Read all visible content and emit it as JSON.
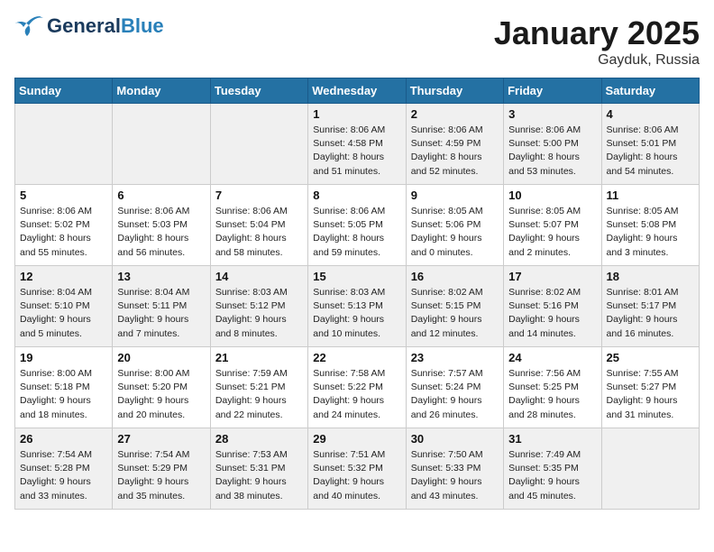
{
  "header": {
    "logo_general": "General",
    "logo_blue": "Blue",
    "month": "January 2025",
    "location": "Gayduk, Russia"
  },
  "weekdays": [
    "Sunday",
    "Monday",
    "Tuesday",
    "Wednesday",
    "Thursday",
    "Friday",
    "Saturday"
  ],
  "weeks": [
    [
      {
        "day": "",
        "info": ""
      },
      {
        "day": "",
        "info": ""
      },
      {
        "day": "",
        "info": ""
      },
      {
        "day": "1",
        "info": "Sunrise: 8:06 AM\nSunset: 4:58 PM\nDaylight: 8 hours\nand 51 minutes."
      },
      {
        "day": "2",
        "info": "Sunrise: 8:06 AM\nSunset: 4:59 PM\nDaylight: 8 hours\nand 52 minutes."
      },
      {
        "day": "3",
        "info": "Sunrise: 8:06 AM\nSunset: 5:00 PM\nDaylight: 8 hours\nand 53 minutes."
      },
      {
        "day": "4",
        "info": "Sunrise: 8:06 AM\nSunset: 5:01 PM\nDaylight: 8 hours\nand 54 minutes."
      }
    ],
    [
      {
        "day": "5",
        "info": "Sunrise: 8:06 AM\nSunset: 5:02 PM\nDaylight: 8 hours\nand 55 minutes."
      },
      {
        "day": "6",
        "info": "Sunrise: 8:06 AM\nSunset: 5:03 PM\nDaylight: 8 hours\nand 56 minutes."
      },
      {
        "day": "7",
        "info": "Sunrise: 8:06 AM\nSunset: 5:04 PM\nDaylight: 8 hours\nand 58 minutes."
      },
      {
        "day": "8",
        "info": "Sunrise: 8:06 AM\nSunset: 5:05 PM\nDaylight: 8 hours\nand 59 minutes."
      },
      {
        "day": "9",
        "info": "Sunrise: 8:05 AM\nSunset: 5:06 PM\nDaylight: 9 hours\nand 0 minutes."
      },
      {
        "day": "10",
        "info": "Sunrise: 8:05 AM\nSunset: 5:07 PM\nDaylight: 9 hours\nand 2 minutes."
      },
      {
        "day": "11",
        "info": "Sunrise: 8:05 AM\nSunset: 5:08 PM\nDaylight: 9 hours\nand 3 minutes."
      }
    ],
    [
      {
        "day": "12",
        "info": "Sunrise: 8:04 AM\nSunset: 5:10 PM\nDaylight: 9 hours\nand 5 minutes."
      },
      {
        "day": "13",
        "info": "Sunrise: 8:04 AM\nSunset: 5:11 PM\nDaylight: 9 hours\nand 7 minutes."
      },
      {
        "day": "14",
        "info": "Sunrise: 8:03 AM\nSunset: 5:12 PM\nDaylight: 9 hours\nand 8 minutes."
      },
      {
        "day": "15",
        "info": "Sunrise: 8:03 AM\nSunset: 5:13 PM\nDaylight: 9 hours\nand 10 minutes."
      },
      {
        "day": "16",
        "info": "Sunrise: 8:02 AM\nSunset: 5:15 PM\nDaylight: 9 hours\nand 12 minutes."
      },
      {
        "day": "17",
        "info": "Sunrise: 8:02 AM\nSunset: 5:16 PM\nDaylight: 9 hours\nand 14 minutes."
      },
      {
        "day": "18",
        "info": "Sunrise: 8:01 AM\nSunset: 5:17 PM\nDaylight: 9 hours\nand 16 minutes."
      }
    ],
    [
      {
        "day": "19",
        "info": "Sunrise: 8:00 AM\nSunset: 5:18 PM\nDaylight: 9 hours\nand 18 minutes."
      },
      {
        "day": "20",
        "info": "Sunrise: 8:00 AM\nSunset: 5:20 PM\nDaylight: 9 hours\nand 20 minutes."
      },
      {
        "day": "21",
        "info": "Sunrise: 7:59 AM\nSunset: 5:21 PM\nDaylight: 9 hours\nand 22 minutes."
      },
      {
        "day": "22",
        "info": "Sunrise: 7:58 AM\nSunset: 5:22 PM\nDaylight: 9 hours\nand 24 minutes."
      },
      {
        "day": "23",
        "info": "Sunrise: 7:57 AM\nSunset: 5:24 PM\nDaylight: 9 hours\nand 26 minutes."
      },
      {
        "day": "24",
        "info": "Sunrise: 7:56 AM\nSunset: 5:25 PM\nDaylight: 9 hours\nand 28 minutes."
      },
      {
        "day": "25",
        "info": "Sunrise: 7:55 AM\nSunset: 5:27 PM\nDaylight: 9 hours\nand 31 minutes."
      }
    ],
    [
      {
        "day": "26",
        "info": "Sunrise: 7:54 AM\nSunset: 5:28 PM\nDaylight: 9 hours\nand 33 minutes."
      },
      {
        "day": "27",
        "info": "Sunrise: 7:54 AM\nSunset: 5:29 PM\nDaylight: 9 hours\nand 35 minutes."
      },
      {
        "day": "28",
        "info": "Sunrise: 7:53 AM\nSunset: 5:31 PM\nDaylight: 9 hours\nand 38 minutes."
      },
      {
        "day": "29",
        "info": "Sunrise: 7:51 AM\nSunset: 5:32 PM\nDaylight: 9 hours\nand 40 minutes."
      },
      {
        "day": "30",
        "info": "Sunrise: 7:50 AM\nSunset: 5:33 PM\nDaylight: 9 hours\nand 43 minutes."
      },
      {
        "day": "31",
        "info": "Sunrise: 7:49 AM\nSunset: 5:35 PM\nDaylight: 9 hours\nand 45 minutes."
      },
      {
        "day": "",
        "info": ""
      }
    ]
  ],
  "shaded_rows": [
    0,
    2,
    4
  ],
  "empty_first_row_cols": [
    0,
    1,
    2
  ],
  "empty_last_row_cols": [
    6
  ]
}
